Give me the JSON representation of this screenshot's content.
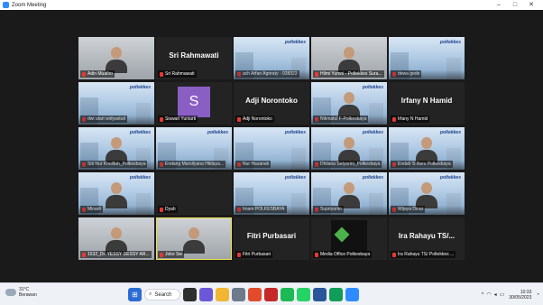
{
  "window": {
    "title": "Zoom Meeting",
    "controls": [
      "minimize-icon",
      "maximize-icon",
      "close-icon"
    ]
  },
  "participants": [
    {
      "name": "Adin Muafiro",
      "kind": "video-person"
    },
    {
      "name": "Sri Rahmawati",
      "display": "Sri Rahmawati",
      "kind": "name-only"
    },
    {
      "name": "ach Arfan Agnraty - 028322",
      "kind": "video-room"
    },
    {
      "name": "Hilmi Yumni - Poltekkes Sura...",
      "kind": "video-person"
    },
    {
      "name": "dewa gede",
      "kind": "video-bg"
    },
    {
      "name": "dwi utari widyastuti",
      "kind": "video-bg"
    },
    {
      "name": "Siswari Yuniarti",
      "initial": "S",
      "kind": "avatar"
    },
    {
      "name": "Adji Norontoko",
      "display": "Adji Norontoko",
      "kind": "name-only"
    },
    {
      "name": "Nikmatul F-Polkesbaya",
      "kind": "video-bg-person"
    },
    {
      "name": "Irfany N Hamid",
      "display": "Irfany N Hamid",
      "kind": "name-only"
    },
    {
      "name": "Siti Nur Kholifah_Polkesbaya",
      "kind": "video-bg-person"
    },
    {
      "name": "Endang Marsilyana Hildaya...",
      "kind": "video-bg"
    },
    {
      "name": "Nur Hasanah",
      "kind": "video-bg"
    },
    {
      "name": "Dhilana Setyorini_Polkesbaya",
      "kind": "video-bg-person"
    },
    {
      "name": "Endah S-Ners Polkesbaya",
      "kind": "video-bg-person"
    },
    {
      "name": "Minarti",
      "kind": "video-bg-person"
    },
    {
      "name": "Dyah",
      "kind": "blank"
    },
    {
      "name": "Imam POLKESBAYA",
      "kind": "video-bg"
    },
    {
      "name": "Supriyanto",
      "kind": "video-bg-person"
    },
    {
      "name": "Wijaya Dinar",
      "kind": "video-bg-person"
    },
    {
      "name": "1532_Dr. YESSY DESSY AR...",
      "kind": "video-person"
    },
    {
      "name": "Joko Sw",
      "kind": "video-person",
      "active": true
    },
    {
      "name": "Fitri Purbasari",
      "display": "Fitri Purbasari",
      "kind": "name-only"
    },
    {
      "name": "Media Office Polkesbaya",
      "kind": "logo"
    },
    {
      "name": "Ira Rahayu TS/ Poltekkes ...",
      "display": "Ira Rahayu TS/...",
      "kind": "name-only"
    }
  ],
  "bg_logo": "poltekkes",
  "taskbar": {
    "weather": {
      "temp": "31°C",
      "condition": "Berawan"
    },
    "search_label": "Search",
    "tray": {
      "time": "10:33",
      "date": "30/05/2023",
      "lang": "^"
    }
  },
  "colors": {
    "active_speaker": "#f0e34a",
    "avatar_bg": "#8a5fc3",
    "mic_muted": "#e53935"
  }
}
